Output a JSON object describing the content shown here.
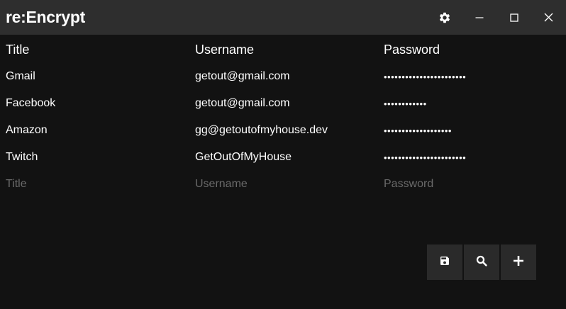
{
  "app": {
    "title": "re:Encrypt"
  },
  "titlebar": {
    "buttons": [
      {
        "name": "settings",
        "icon": "gear-icon"
      },
      {
        "name": "minimize",
        "icon": "minimize-icon"
      },
      {
        "name": "maximize",
        "icon": "maximize-icon"
      },
      {
        "name": "close",
        "icon": "close-icon"
      }
    ]
  },
  "table": {
    "headers": {
      "title": "Title",
      "username": "Username",
      "password": "Password"
    },
    "rows": [
      {
        "title": "Gmail",
        "username": "getout@gmail.com",
        "password": "•••••••••••••••••••••••"
      },
      {
        "title": "Facebook",
        "username": "getout@gmail.com",
        "password": "••••••••••••"
      },
      {
        "title": "Amazon",
        "username": "gg@getoutofmyhouse.dev",
        "password": "•••••••••••••••••••"
      },
      {
        "title": "Twitch",
        "username": "GetOutOfMyHouse",
        "password": "•••••••••••••••••••••••"
      }
    ],
    "new_entry": {
      "title_placeholder": "Title",
      "username_placeholder": "Username",
      "password_placeholder": "Password"
    }
  },
  "actions": [
    {
      "name": "save",
      "icon": "save-icon"
    },
    {
      "name": "search",
      "icon": "search-icon"
    },
    {
      "name": "add",
      "icon": "plus-icon"
    }
  ],
  "colors": {
    "background": "#121212",
    "titlebar": "#2e2e2e",
    "button": "#2a2a2a",
    "text": "#ffffff",
    "placeholder": "#6a6a6a"
  }
}
